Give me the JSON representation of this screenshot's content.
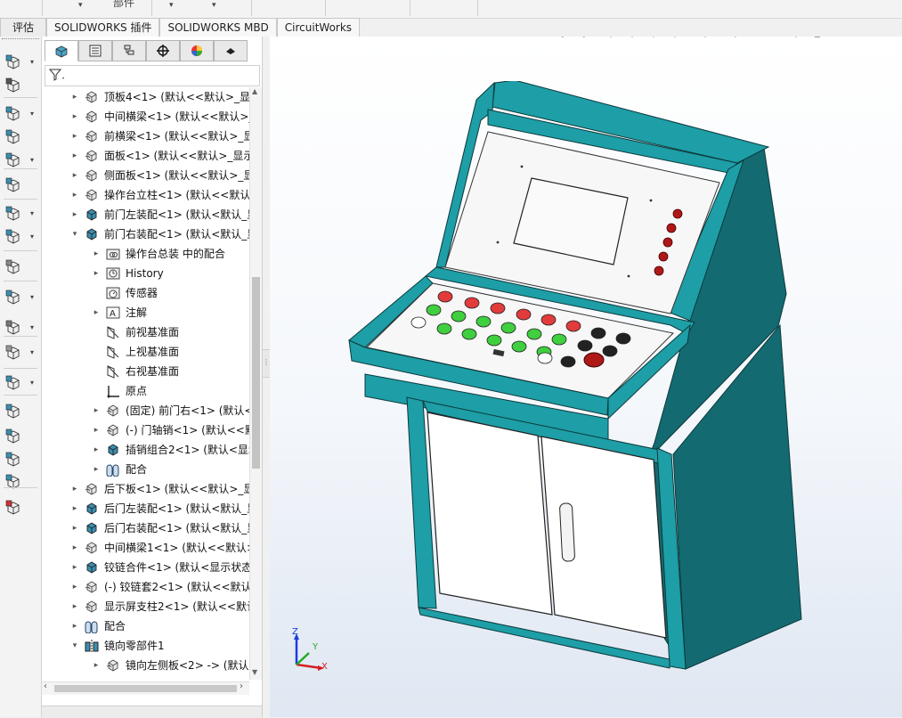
{
  "app": {
    "partial_title_text": "部件"
  },
  "tabs": [
    {
      "label": "评估"
    },
    {
      "label": "SOLIDWORKS 插件"
    },
    {
      "label": "SOLIDWORKS MBD"
    },
    {
      "label": "CircuitWorks"
    }
  ],
  "panel_tabs": [
    {
      "icon": "feature-manager-icon",
      "active": true
    },
    {
      "icon": "property-manager-icon"
    },
    {
      "icon": "configuration-manager-icon"
    },
    {
      "icon": "dimxpert-manager-icon"
    },
    {
      "icon": "display-manager-icon"
    },
    {
      "icon": "cam-manager-icon"
    }
  ],
  "filter": {
    "icon": "filter-icon"
  },
  "tree": [
    {
      "level": 0,
      "expand": "▸",
      "icon": "part-icon",
      "label": "顶板4<1> (默认<<默认>_显示"
    },
    {
      "level": 0,
      "expand": "▸",
      "icon": "part-icon",
      "label": "中间横梁<1> (默认<<默认>_"
    },
    {
      "level": 0,
      "expand": "▸",
      "icon": "part-icon",
      "label": "前横梁<1> (默认<<默认>_显"
    },
    {
      "level": 0,
      "expand": "▸",
      "icon": "part-icon",
      "label": "面板<1> (默认<<默认>_显示"
    },
    {
      "level": 0,
      "expand": "▸",
      "icon": "part-icon",
      "label": "侧面板<1> (默认<<默认>_显"
    },
    {
      "level": 0,
      "expand": "▸",
      "icon": "part-icon",
      "label": "操作台立柱<1> (默认<<默认"
    },
    {
      "level": 0,
      "expand": "▸",
      "icon": "assembly-icon",
      "label": "前门左装配<1> (默认<默认_显"
    },
    {
      "level": 0,
      "expand": "▾",
      "icon": "assembly-icon",
      "label": "前门右装配<1> (默认<默认_显"
    },
    {
      "level": 1,
      "expand": "▸",
      "icon": "mates-folder-icon",
      "label": "操作台总装 中的配合"
    },
    {
      "level": 1,
      "expand": "▸",
      "icon": "history-icon",
      "label": "History"
    },
    {
      "level": 1,
      "expand": "",
      "icon": "sensor-icon",
      "label": "传感器"
    },
    {
      "level": 1,
      "expand": "▸",
      "icon": "annotation-icon",
      "label": "注解"
    },
    {
      "level": 1,
      "expand": "",
      "icon": "plane-icon",
      "label": "前视基准面"
    },
    {
      "level": 1,
      "expand": "",
      "icon": "plane-icon",
      "label": "上视基准面"
    },
    {
      "level": 1,
      "expand": "",
      "icon": "plane-icon",
      "label": "右视基准面"
    },
    {
      "level": 1,
      "expand": "",
      "icon": "origin-icon",
      "label": "原点"
    },
    {
      "level": 1,
      "expand": "▸",
      "icon": "part-icon",
      "label": "(固定) 前门右<1> (默认<"
    },
    {
      "level": 1,
      "expand": "▸",
      "icon": "part-icon",
      "label": "(-) 门轴销<1> (默认<<默"
    },
    {
      "level": 1,
      "expand": "▸",
      "icon": "assembly-icon",
      "label": "插销组合2<1> (默认<显示"
    },
    {
      "level": 1,
      "expand": "▸",
      "icon": "mate-icon",
      "label": "配合"
    },
    {
      "level": 0,
      "expand": "▸",
      "icon": "part-icon",
      "label": "后下板<1> (默认<<默认>_显"
    },
    {
      "level": 0,
      "expand": "▸",
      "icon": "assembly-icon",
      "label": "后门左装配<1> (默认<默认_显"
    },
    {
      "level": 0,
      "expand": "▸",
      "icon": "assembly-icon",
      "label": "后门右装配<1> (默认<默认_显"
    },
    {
      "level": 0,
      "expand": "▸",
      "icon": "part-icon",
      "label": "中间横梁1<1> (默认<<默认>"
    },
    {
      "level": 0,
      "expand": "▸",
      "icon": "assembly-icon",
      "label": "铰链合件<1> (默认<显示状态"
    },
    {
      "level": 0,
      "expand": "▸",
      "icon": "part-icon",
      "label": "(-) 铰链套2<1> (默认<<默认"
    },
    {
      "level": 0,
      "expand": "▸",
      "icon": "part-icon",
      "label": "显示屏支柱2<1> (默认<<默认"
    },
    {
      "level": 0,
      "expand": "▸",
      "icon": "mate-icon",
      "label": "配合"
    },
    {
      "level": 0,
      "expand": "▾",
      "icon": "mirror-component-icon",
      "label": "镜向零部件1"
    },
    {
      "level": 1,
      "expand": "▸",
      "icon": "part-icon",
      "label": "镜向左侧板<2> -> (默认"
    }
  ],
  "command_icons": [
    "insert-components-icon",
    "mate-icon",
    "linear-pattern-icon",
    "smart-fasteners-icon",
    "move-component-icon",
    "show-hidden-icon",
    "assembly-features-icon",
    "reference-geometry-icon",
    "new-motion-study-icon",
    "bill-of-materials-icon",
    "exploded-view-icon",
    "instant3d-icon",
    "update-speedpak-icon",
    "take-snapshot-icon",
    "large-assembly-icon",
    "interference-detection-icon",
    "clearance-verification-icon",
    "hole-alignment-icon",
    "measure-icon"
  ],
  "heads_up_icons": [
    "zoom-to-fit-icon",
    "zoom-to-area-icon",
    "previous-view-icon",
    "section-view-icon",
    "dynamic-annotation-icon",
    "view-orientation-icon",
    "display-style-icon",
    "hide-show-items-icon",
    "edit-appearance-icon",
    "apply-scene-icon",
    "view-settings-icon"
  ],
  "triad": {
    "x_label": "X",
    "y_label": "Y",
    "z_label": "Z"
  },
  "colors": {
    "cabinet_teal": "#1e9ea6",
    "cabinet_dark": "#136a70",
    "panel_white": "#f7f7f7",
    "button_red": "#e23b3b",
    "button_green": "#3fcf3f",
    "button_black": "#222222",
    "indicator_dark_red": "#b01818"
  }
}
